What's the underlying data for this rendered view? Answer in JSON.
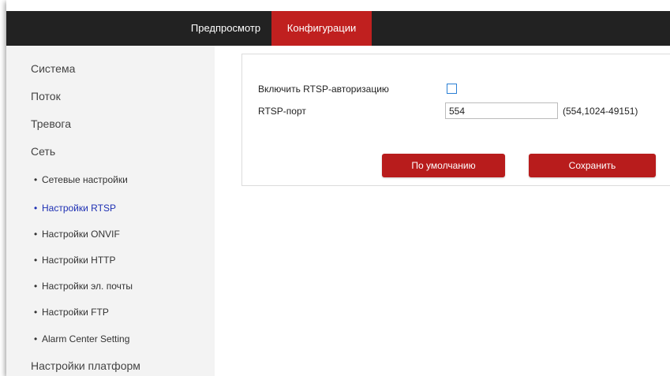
{
  "header": {
    "tabs": [
      {
        "label": "Предпросмотр",
        "active": false
      },
      {
        "label": "Конфигурации",
        "active": true
      }
    ]
  },
  "sidebar": {
    "items": [
      {
        "label": "Система"
      },
      {
        "label": "Поток"
      },
      {
        "label": "Тревога"
      },
      {
        "label": "Сеть"
      }
    ],
    "sub_items": [
      {
        "label": "Сетевые настройки",
        "active": false
      },
      {
        "label": "Настройки RTSP",
        "active": true
      },
      {
        "label": "Настройки ONVIF",
        "active": false
      },
      {
        "label": "Настройки HTTP",
        "active": false
      },
      {
        "label": "Настройки эл. почты",
        "active": false
      },
      {
        "label": "Настройки FTP",
        "active": false
      },
      {
        "label": "Alarm Center Setting",
        "active": false
      }
    ],
    "last_item": {
      "label": "Настройки платформ"
    },
    "bullet": "•"
  },
  "form": {
    "auth_label": "Включить RTSP-авторизацию",
    "auth_checked": false,
    "port_label": "RTSP-порт",
    "port_value": "554",
    "port_range": "(554,1024-49151)",
    "default_button": "По умолчанию",
    "save_button": "Сохранить"
  },
  "colors": {
    "topbar": "#222222",
    "accent": "#c0201f",
    "button": "#b81c1c",
    "active_link": "#1d2fb3",
    "sidebar_bg": "#f3f3f3"
  }
}
